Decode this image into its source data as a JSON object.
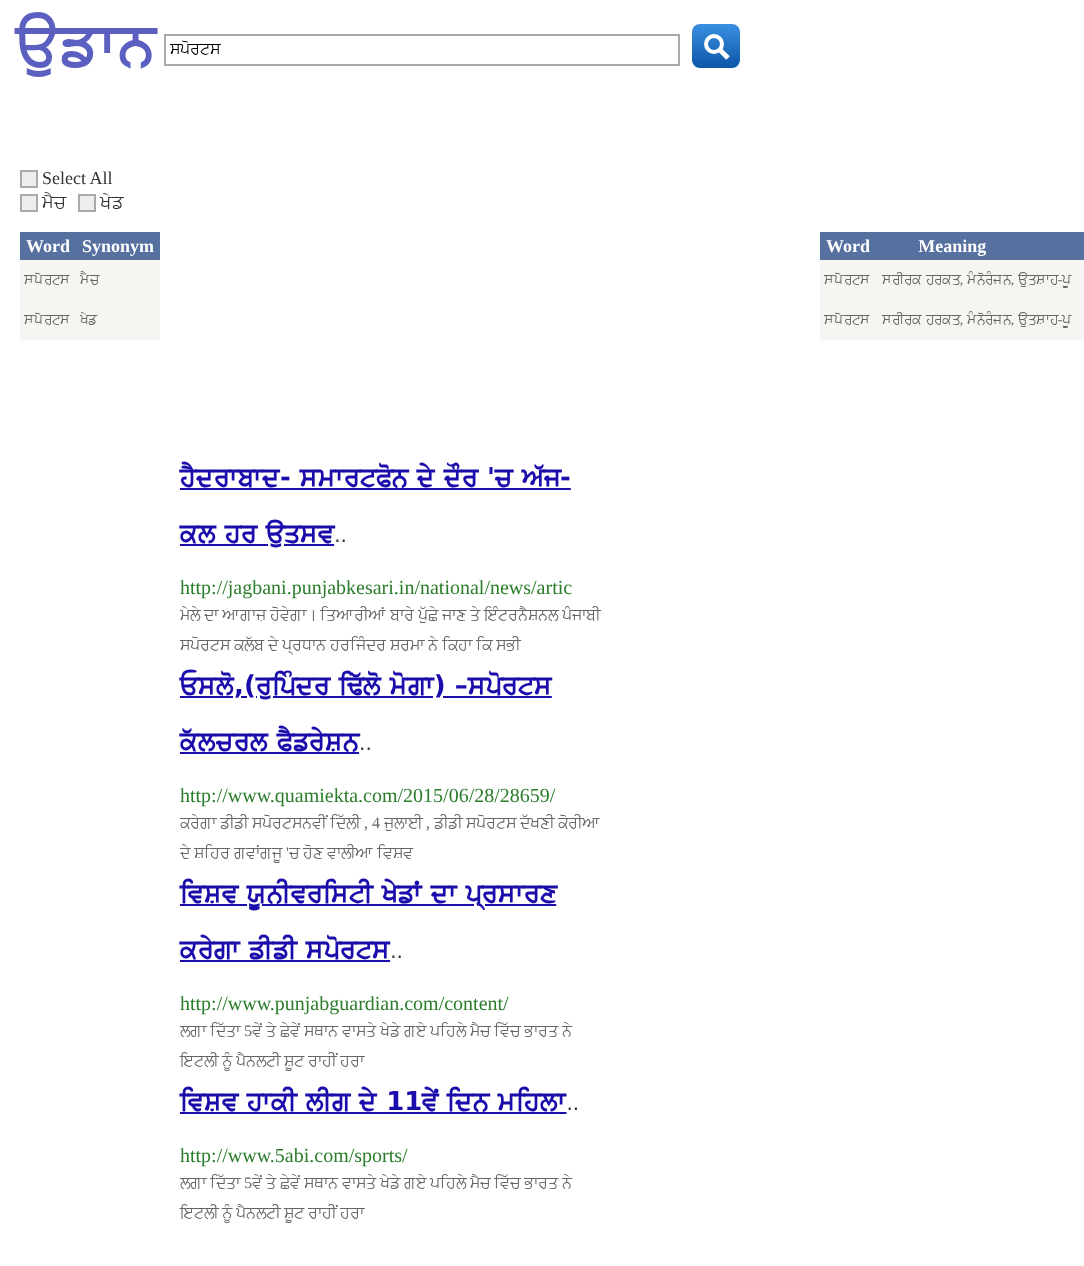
{
  "logo": "ਉਡਾਨ",
  "search": {
    "value": "ਸਪੋਰਟਸ"
  },
  "select_all": {
    "label": "Select All",
    "checked": false
  },
  "filters": [
    {
      "label": "ਮੈਚ",
      "checked": false
    },
    {
      "label": "ਖੇਡ",
      "checked": false
    }
  ],
  "synonym_table": {
    "columns": [
      "Word",
      "Synonym"
    ],
    "rows": [
      [
        "ਸਪੋਰਟਸ",
        "ਮੈਚ"
      ],
      [
        "ਸਪੋਰਟਸ",
        "ਖੇਡ"
      ]
    ]
  },
  "meaning_table": {
    "columns": [
      "Word",
      "Meaning"
    ],
    "rows": [
      [
        "ਸਪੋਰਟਸ",
        "ਸਰੀਰਕ ਹਰਕਤ, ਮੰਨੋਰੰਜਨ, ਉਤਸ਼ਾਹ-ਪੂ"
      ],
      [
        "ਸਪੋਰਟਸ",
        "ਸਰੀਰਕ ਹਰਕਤ, ਮੰਨੋਰੰਜਨ, ਉਤਸ਼ਾਹ-ਪੂ"
      ]
    ]
  },
  "results": [
    {
      "title_lines": [
        "ਹੈਦਰਾਬਾਦ- ਸਮਾਰਟਫੋਨ ਦੇ ਦੌਰ 'ਚ ਅੱਜ-",
        "ਕਲ ਹਰ ਉਤਸਵ"
      ],
      "ellipsis": "..",
      "url": "http://jagbani.punjabkesari.in/national/news/artic",
      "snippet": "ਮੇਲੇ ਦਾ ਆਗਾਜ਼ ਹੋਵੇਗਾ। ਤਿਆਰੀਆਂ ਬਾਰੇ ਪੁੱਛੇ ਜਾਣ ਤੇ ਇੰਟਰਨੈਸ਼ਨਲ ਪੰਜਾਬੀ ਸਪੋਰਟਸ ਕਲੱਬ ਦੇ ਪ੍ਰਧਾਨ ਹਰਜਿੰਦਰ ਸ਼ਰਮਾ ਨੇ ਕਿਹਾ ਕਿ ਸਭੀ"
    },
    {
      "title_lines": [
        "ਓਸਲੋ,(ਰੁਪਿੰਦਰ ਢਿੱਲੋ ਮੋਗਾ) –ਸਪੋਰਟਸ",
        "ਕੱਲਚਰਲ ਫੈਡਰੇਸ਼ਨ"
      ],
      "ellipsis": "..",
      "url": "http://www.quamiekta.com/2015/06/28/28659/",
      "snippet": "ਕਰੇਗਾ ਡੀਡੀ ਸਪੋਰਟਸਨਵੀਂ ਦਿੱਲੀ , 4 ਜੁਲਾਈ , ਡੀਡੀ ਸਪੋਰਟਸ ਦੱਖਣੀ ਕੋਰੀਆ ਦੇ ਸ਼ਹਿਰ ਗਵਾਂਗਜੂ 'ਚ ਹੋਣ ਵਾਲੀਆ ਵਿਸ਼ਵ"
    },
    {
      "title_lines": [
        "ਵਿਸ਼ਵ ਯੂਨੀਵਰਸਿਟੀ ਖੇਡਾਂ ਦਾ ਪ੍ਰਸਾਰਣ",
        "ਕਰੇਗਾ ਡੀਡੀ ਸਪੋਰਟਸ"
      ],
      "ellipsis": "..",
      "url": "http://www.punjabguardian.com/content/",
      "snippet": "ਲਗਾ ਦਿੱਤਾ 5ਵੇਂ ਤੇ ਛੇਵੇਂ ਸਥਾਨ ਵਾਸਤੇ ਖੇਡੇ ਗਏ ਪਹਿਲੇ ਮੈਚ ਵਿੱਚ ਭਾਰਤ ਨੇ ਇਟਲੀ ਨੂੰ ਪੈਨਲਟੀ ਸ਼ੂਟ ਰਾਹੀਂ ਹਰਾ"
    },
    {
      "title_lines": [
        "ਵਿਸ਼ਵ ਹਾਕੀ ਲੀਗ ਦੇ 11ਵੇਂ ਦਿਨ ਮਹਿਲਾ"
      ],
      "ellipsis": "..",
      "url": "http://www.5abi.com/sports/",
      "snippet": "ਲਗਾ ਦਿੱਤਾ 5ਵੇਂ ਤੇ ਛੇਵੇਂ ਸਥਾਨ ਵਾਸਤੇ ਖੇਡੇ ਗਏ ਪਹਿਲੇ ਮੈਚ ਵਿੱਚ ਭਾਰਤ ਨੇ ਇਟਲੀ ਨੂੰ ਪੈਨਲਟੀ ਸ਼ੂਟ ਰਾਹੀਂ ਹਰਾ"
    }
  ]
}
